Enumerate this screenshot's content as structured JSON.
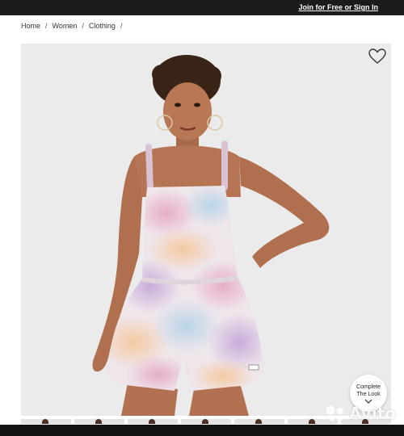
{
  "topbar": {
    "signin_label": "Join for Free or Sign In"
  },
  "breadcrumb": {
    "items": [
      "Home",
      "Women",
      "Clothing"
    ],
    "separator": "/"
  },
  "product": {
    "image_subject": "model wearing pastel tie-dye strappy romper",
    "favorite_icon": "heart-outline-icon",
    "complete_look": {
      "line1": "Complete",
      "line2": "The Look",
      "icon": "chevron-down-icon"
    }
  },
  "thumbnails": {
    "count": 7
  },
  "watermark": {
    "text": "Avito"
  },
  "colors": {
    "topbar": "#1b1b1b",
    "image_bg": "#ecebeb",
    "bottombar": "#121212"
  }
}
